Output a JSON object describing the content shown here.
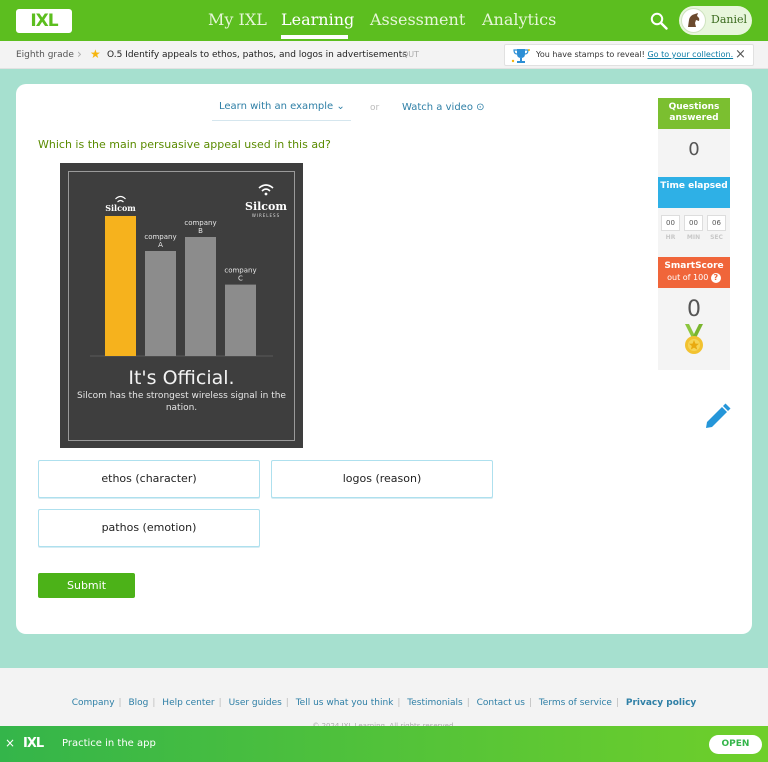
{
  "nav": {
    "logo": "IXL",
    "links": [
      "My IXL",
      "Learning",
      "Assessment",
      "Analytics"
    ],
    "active": "Learning",
    "user": "Daniel"
  },
  "breadcrumb": {
    "grade": "Eighth grade",
    "skill": "O.5 Identify appeals to ethos, pathos, and logos in advertisements",
    "code": "QUT"
  },
  "stamps": {
    "message": "You have stamps to reveal!",
    "link": "Go to your collection."
  },
  "help": {
    "learn": "Learn with an example",
    "or": "or",
    "video": "Watch a video"
  },
  "question": "Which is the main persuasive appeal used in this ad?",
  "ad": {
    "headline": "It's Official.",
    "subtext": "Silcom has the strongest wireless signal in the nation.",
    "brand": "Silcom",
    "brand_tag": "WIRELESS"
  },
  "chart_data": {
    "type": "bar",
    "categories": [
      "Silcom",
      "company A",
      "company B",
      "company C"
    ],
    "values": [
      100,
      75,
      85,
      51
    ],
    "colors": [
      "#f6b21d",
      "#8c8c8c",
      "#8c8c8c",
      "#8c8c8c"
    ],
    "title": "",
    "xlabel": "",
    "ylabel": ""
  },
  "choices": [
    "ethos (character)",
    "logos (reason)",
    "pathos (emotion)"
  ],
  "submit": "Submit",
  "stats": {
    "questions_label": "Questions answered",
    "questions_value": "0",
    "time_label": "Time elapsed",
    "time": {
      "hr": "00",
      "min": "00",
      "sec": "06"
    },
    "time_units": {
      "hr": "HR",
      "min": "MIN",
      "sec": "SEC"
    },
    "smartscore_label": "SmartScore",
    "smartscore_sub": "out of 100",
    "smartscore_value": "0",
    "colors": {
      "questions": "#7bbf30",
      "time": "#2eb0e6",
      "smartscore": "#f0653a"
    }
  },
  "footer": {
    "links": [
      "Company",
      "Blog",
      "Help center",
      "User guides",
      "Tell us what you think",
      "Testimonials",
      "Contact us",
      "Terms of service",
      "Privacy policy"
    ],
    "copyright": "© 2024 IXL Learning. All rights reserved."
  },
  "appbar": {
    "logo": "IXL",
    "text": "Practice in the app",
    "open": "OPEN"
  }
}
